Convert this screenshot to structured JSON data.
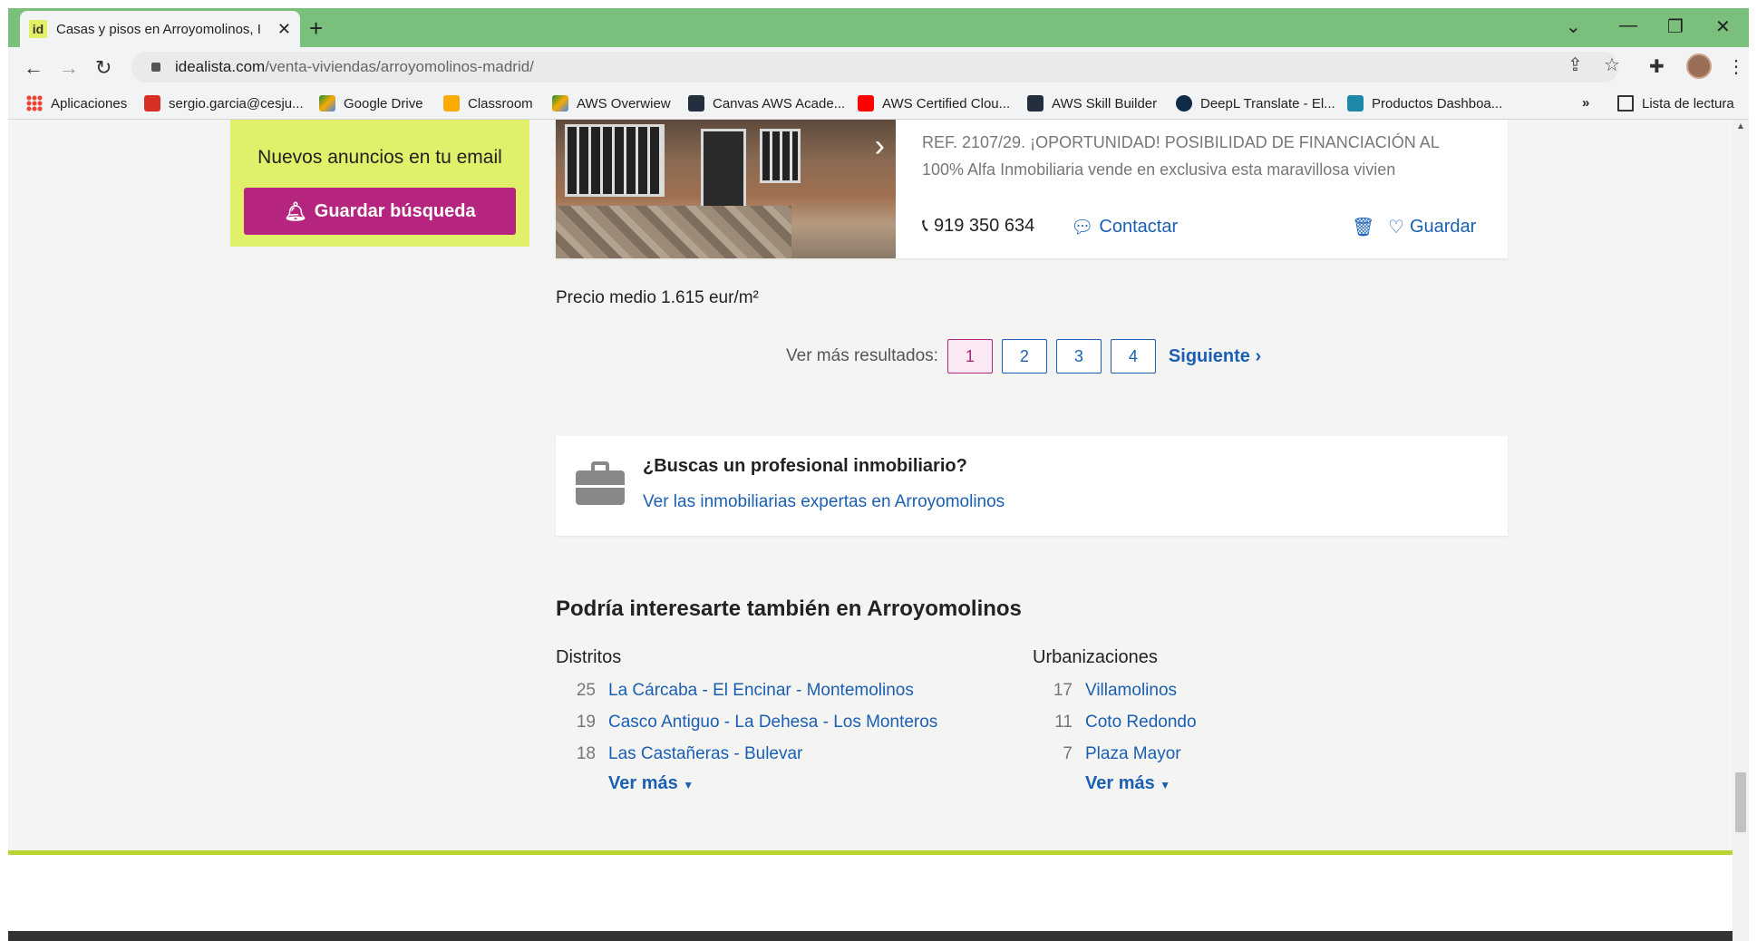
{
  "browser": {
    "tab_title": "Casas y pisos en Arroyomolinos, I",
    "tab_favicon": "id",
    "url_host": "idealista.com",
    "url_path": "/venta-viviendas/arroyomolinos-madrid/",
    "bookmarks": [
      {
        "label": "Aplicaciones",
        "icon": "apps-grid-icon",
        "color": "#ea4335"
      },
      {
        "label": "sergio.garcia@cesju...",
        "icon": "gmail-icon",
        "color": "#d93025"
      },
      {
        "label": "Google Drive",
        "icon": "drive-icon",
        "color": "#1e8e3e"
      },
      {
        "label": "Classroom",
        "icon": "classroom-icon",
        "color": "#f9ab00"
      },
      {
        "label": "AWS Overwiew",
        "icon": "drive-icon",
        "color": "#1e8e3e"
      },
      {
        "label": "Canvas AWS Acade...",
        "icon": "aws-icon",
        "color": "#232f3e"
      },
      {
        "label": "AWS Certified Clou...",
        "icon": "youtube-icon",
        "color": "#ff0000"
      },
      {
        "label": "AWS Skill Builder",
        "icon": "aws-icon",
        "color": "#232f3e"
      },
      {
        "label": "DeepL Translate - El...",
        "icon": "deepl-icon",
        "color": "#0f2b46"
      },
      {
        "label": "Productos Dashboa...",
        "icon": "dashboard-icon",
        "color": "#1e88a8"
      }
    ],
    "overflow_label": "»",
    "reading_list": "Lista de lectura"
  },
  "sidebar": {
    "email_title": "Nuevos anuncios en tu email",
    "save_search_label": "Guardar búsqueda"
  },
  "listing": {
    "description_line1": "REF. 2107/29. ¡OPORTUNIDAD! POSIBILIDAD DE FINANCIACIÓN AL",
    "description_line2": "100% Alfa Inmobiliaria vende en exclusiva esta maravillosa vivien",
    "description_fade": "",
    "phone": "919 350 634",
    "contact_label": "Contactar",
    "save_label": "Guardar"
  },
  "avg_price": "Precio medio 1.615 eur/m²",
  "pagination": {
    "label": "Ver más resultados:",
    "pages": [
      "1",
      "2",
      "3",
      "4"
    ],
    "active": "1",
    "next_label": "Siguiente"
  },
  "pro": {
    "question": "¿Buscas un profesional inmobiliario?",
    "link": "Ver las inmobiliarias expertas en Arroyomolinos"
  },
  "interest": {
    "title": "Podría interesarte también en Arroyomolinos",
    "districts": {
      "heading": "Distritos",
      "items": [
        {
          "count": "25",
          "name": "La Cárcaba - El Encinar - Montemolinos"
        },
        {
          "count": "19",
          "name": "Casco Antiguo - La Dehesa - Los Monteros"
        },
        {
          "count": "18",
          "name": "Las Castañeras - Bulevar"
        }
      ],
      "more": "Ver más"
    },
    "urbanizations": {
      "heading": "Urbanizaciones",
      "items": [
        {
          "count": "17",
          "name": "Villamolinos"
        },
        {
          "count": "11",
          "name": "Coto Redondo"
        },
        {
          "count": "7",
          "name": "Plaza Mayor"
        }
      ],
      "more": "Ver más"
    }
  },
  "colors": {
    "brand_magenta": "#b5257f",
    "email_box": "#e1f06a",
    "link_blue": "#1a5fb4",
    "tabstrip_green": "#7bbf7d"
  }
}
